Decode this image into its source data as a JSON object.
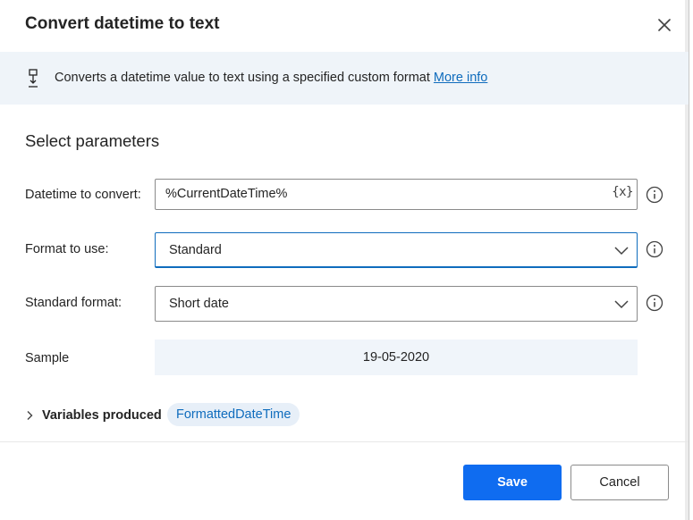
{
  "dialog": {
    "title": "Convert datetime to text"
  },
  "banner": {
    "icon": "datetime-convert-icon",
    "description": "Converts a datetime value to text using a specified custom format",
    "link_label": "More info"
  },
  "params": {
    "section_title": "Select parameters",
    "datetime": {
      "label": "Datetime to convert:",
      "value": "%CurrentDateTime%",
      "variable_button": "{x}"
    },
    "format": {
      "label": "Format to use:",
      "selected": "Standard"
    },
    "standard_format": {
      "label": "Standard format:",
      "selected": "Short date"
    },
    "sample": {
      "label": "Sample",
      "value": "19-05-2020"
    }
  },
  "variables": {
    "toggle_label": "Variables produced",
    "produced": "FormattedDateTime"
  },
  "footer": {
    "save_label": "Save",
    "cancel_label": "Cancel"
  },
  "colors": {
    "primary": "#0f6cf0",
    "link": "#0f6cbd",
    "banner_bg": "#eff4f9"
  }
}
